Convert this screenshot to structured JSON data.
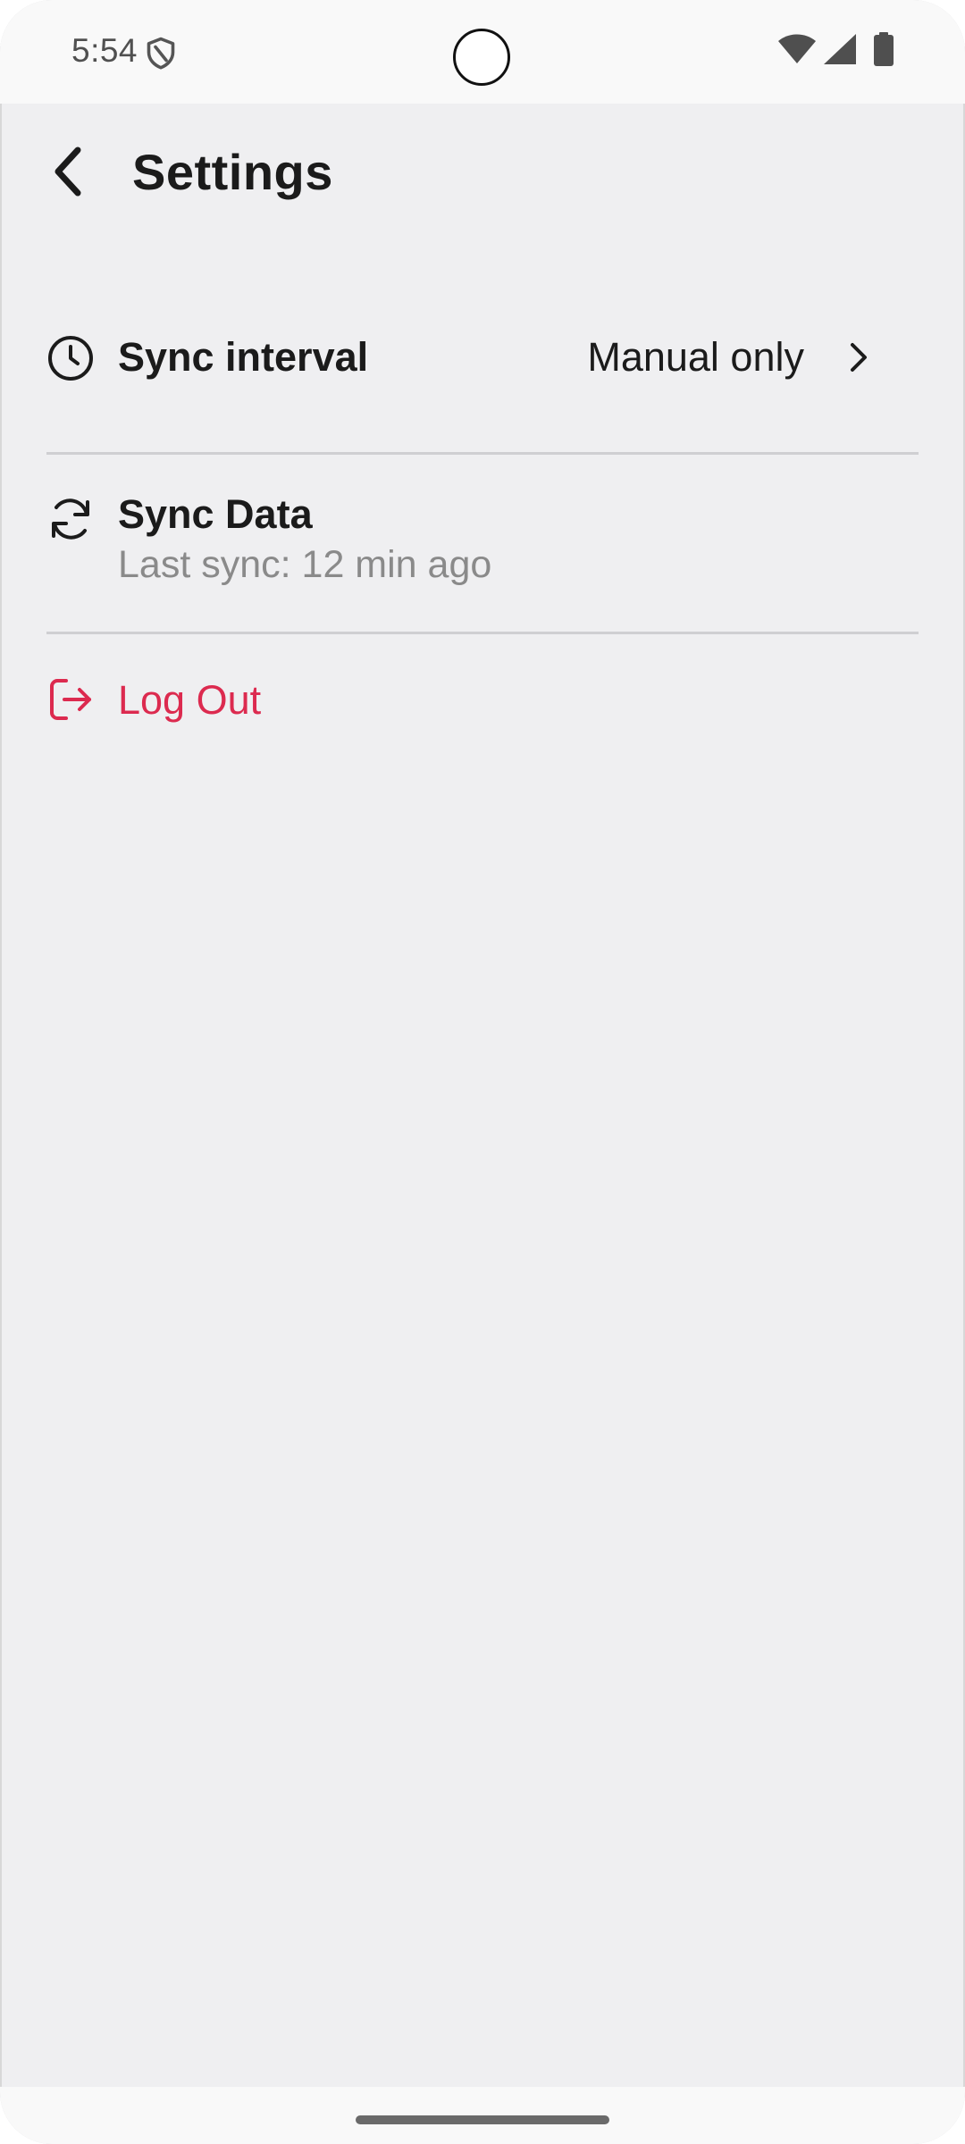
{
  "status_bar": {
    "time": "5:54",
    "icons": [
      "shield-icon",
      "wifi-icon",
      "cellular-signal-icon",
      "battery-icon"
    ]
  },
  "app_bar": {
    "title": "Settings",
    "back_icon": "chevron-left-icon"
  },
  "settings": {
    "sync_interval": {
      "icon": "clock-icon",
      "title": "Sync interval",
      "value": "Manual only",
      "chevron_icon": "chevron-right-icon"
    },
    "sync_data": {
      "icon": "sync-icon",
      "title": "Sync Data",
      "subtitle": "Last sync: 12 min ago"
    },
    "log_out": {
      "icon": "logout-icon",
      "title": "Log Out",
      "color": "#dc2a4f"
    }
  },
  "colors": {
    "background": "#efeff1",
    "text_primary": "#1b1b1b",
    "text_secondary": "#8a8a8a",
    "danger": "#dc2a4f",
    "divider": "#cfcfd2"
  }
}
